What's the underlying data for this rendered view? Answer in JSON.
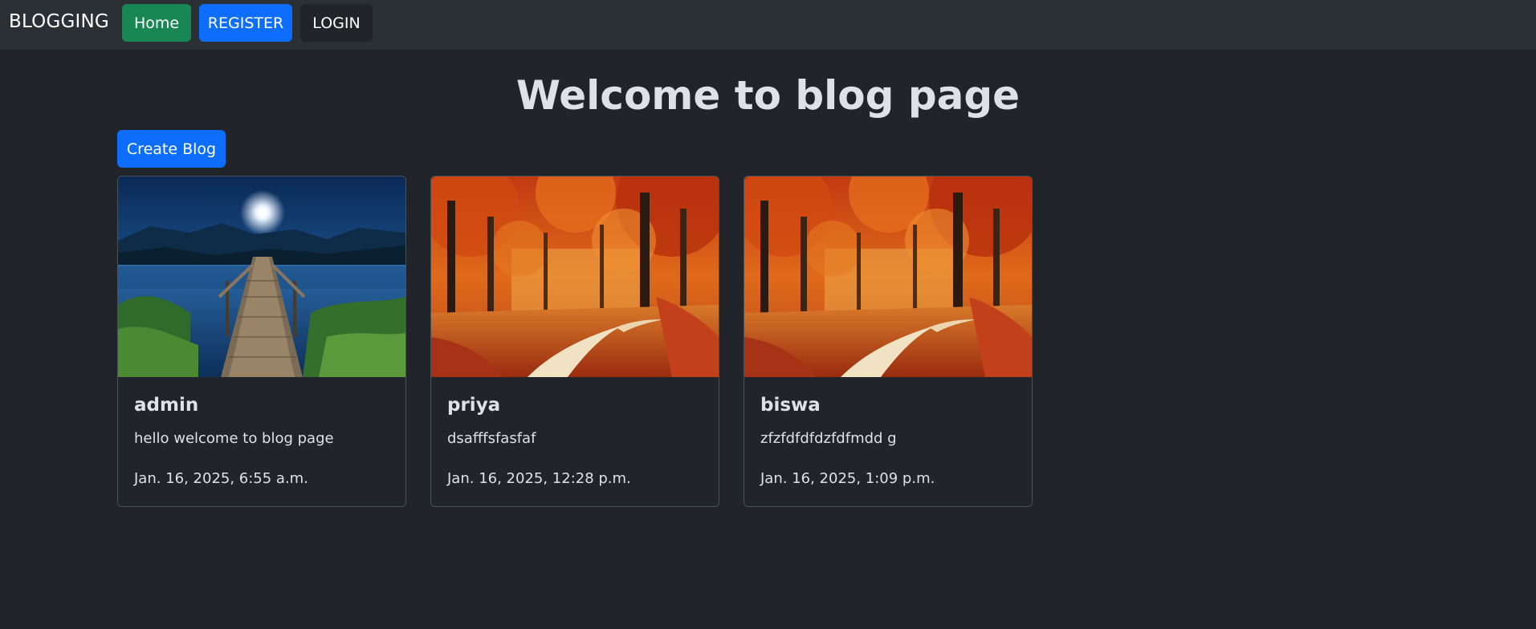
{
  "navbar": {
    "brand": "BLOGGING",
    "home_label": "Home",
    "register_label": "REGISTER",
    "login_label": "LOGIN",
    "colors": {
      "background": "#2b3035",
      "home": "#198754",
      "register": "#0d6efd"
    }
  },
  "main": {
    "title": "Welcome to blog page",
    "create_label": "Create Blog"
  },
  "posts": [
    {
      "author": "admin",
      "content": "hello welcome to blog page",
      "date": "Jan. 16, 2025, 6:55 a.m.",
      "image": "moonlit-lake-pier"
    },
    {
      "author": "priya",
      "content": "dsafffsfasfaf",
      "date": "Jan. 16, 2025, 12:28 p.m.",
      "image": "autumn-forest-path"
    },
    {
      "author": "biswa",
      "content": "zfzfdfdfdzfdfmdd g",
      "date": "Jan. 16, 2025, 1:09 p.m.",
      "image": "autumn-forest-path"
    }
  ]
}
